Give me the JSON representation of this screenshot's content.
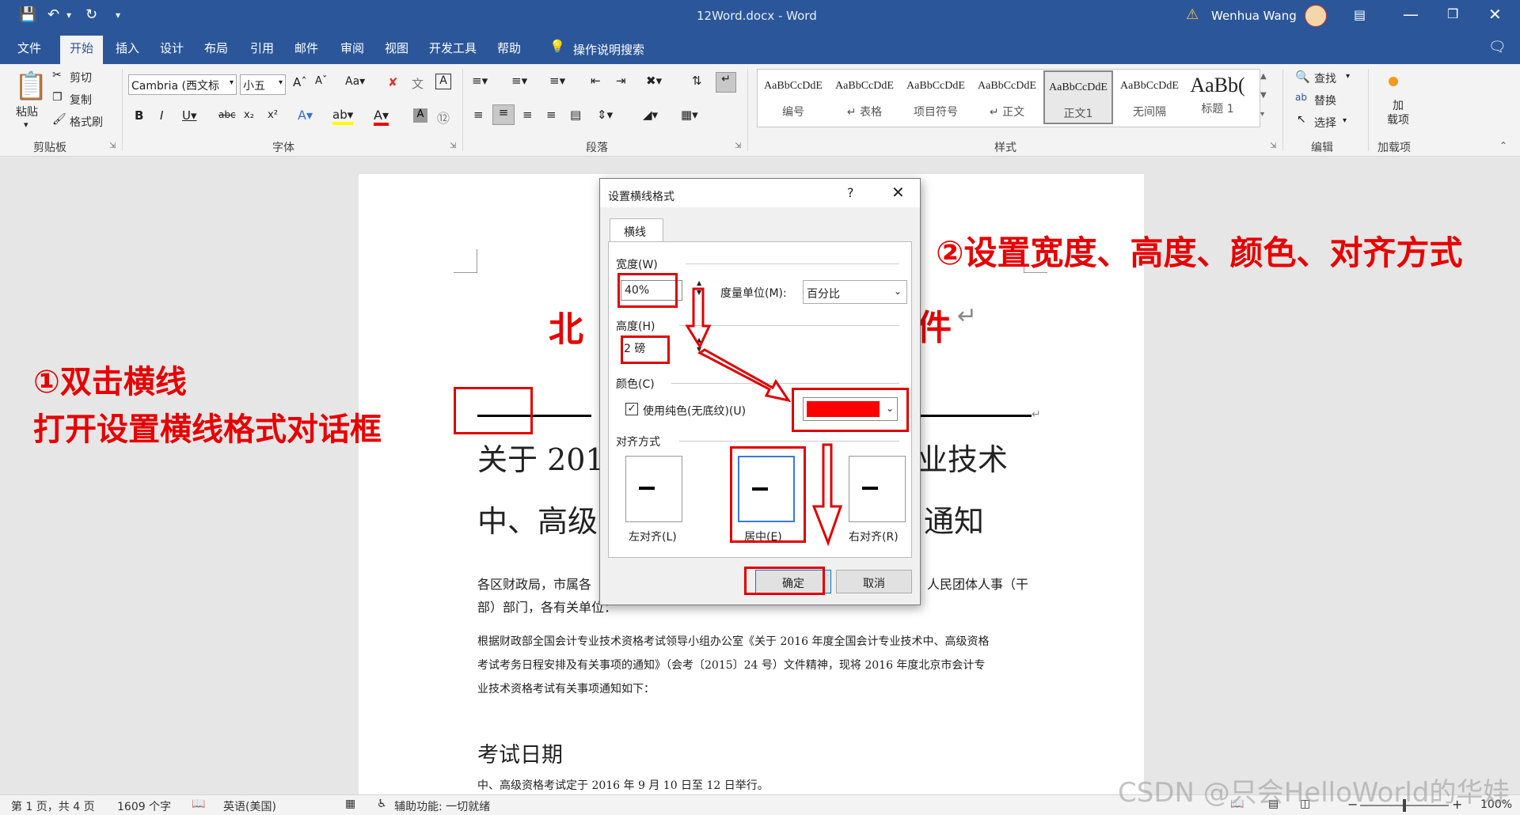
{
  "window": {
    "title": "12Word.docx - Word",
    "user": "Wenhua Wang"
  },
  "tabs": [
    "文件",
    "开始",
    "插入",
    "设计",
    "布局",
    "引用",
    "邮件",
    "审阅",
    "视图",
    "开发工具",
    "帮助"
  ],
  "tell_me": "操作说明搜索",
  "clipboard": {
    "paste": "粘贴",
    "cut": "剪切",
    "copy": "复制",
    "format_painter": "格式刷",
    "label": "剪贴板"
  },
  "font": {
    "name": "Cambria (西文标",
    "size": "小五",
    "label": "字体"
  },
  "paragraph": {
    "label": "段落"
  },
  "styles": {
    "label": "样式",
    "items": [
      {
        "sample": "AaBbCcDdE",
        "name": "编号"
      },
      {
        "sample": "AaBbCcDdE",
        "name": "↵ 表格"
      },
      {
        "sample": "AaBbCcDdE",
        "name": "项目符号"
      },
      {
        "sample": "AaBbCcDdE",
        "name": "↵ 正文"
      },
      {
        "sample": "AaBbCcDdE",
        "name": "正文1"
      },
      {
        "sample": "AaBbCcDdE",
        "name": "无间隔"
      },
      {
        "sample": "AaBb(",
        "name": "标题 1"
      }
    ]
  },
  "editing": {
    "find": "查找",
    "replace": "替换",
    "select": "选择",
    "label": "编辑"
  },
  "addins": {
    "button": "加\n载项",
    "label": "加载项"
  },
  "document": {
    "title_visible_left": "北",
    "title_visible_right": "件",
    "heading_line1_left": "关于 201",
    "heading_line1_right": "业技术",
    "heading_line2_left": "中、高级",
    "heading_line2_right": "通知",
    "para1_line1_left": "各区财政局，市属各",
    "para1_line1_right": "人民团体人事（干",
    "para1_line2": "部）部门，各有关单位：",
    "para2_line1": "根据财政部全国会计专业技术资格考试领导小组办公室《关于 2016 年度全国会计专业技术中、高级资格",
    "para2_line2": "考试考务日程安排及有关事项的通知》（会考〔2015〕24 号）文件精神，现将 2016 年度北京市会计专",
    "para2_line3": "业技术资格考试有关事项通知如下：",
    "section_heading": "考试日期",
    "para3": "中、高级资格考试定于 2016 年 9 月 10 日至 12 日举行。"
  },
  "dialog": {
    "title": "设置横线格式",
    "help": "?",
    "tab": "横线",
    "width_label": "宽度(W)",
    "width_value": "40%",
    "unit_label": "度量单位(M):",
    "unit_value": "百分比",
    "height_label": "高度(H)",
    "height_value": "2 磅",
    "color_label": "颜色(C)",
    "solid_color_label": "使用纯色(无底纹)(U)",
    "solid_color_checked": true,
    "color_value": "#ff0000",
    "align_label": "对齐方式",
    "align_left": "左对齐(L)",
    "align_center": "居中(E)",
    "align_right": "右对齐(R)",
    "align_selected": "center",
    "ok": "确定",
    "cancel": "取消"
  },
  "annotations": {
    "step1_line1": "①双击横线",
    "step1_line2": "打开设置横线格式对话框",
    "step2": "②设置宽度、高度、颜色、对齐方式"
  },
  "status": {
    "page": "第 1 页，共 4 页",
    "words": "1609 个字",
    "language": "英语(美国)",
    "accessibility": "辅助功能: 一切就绪",
    "zoom": "100%"
  },
  "watermark": "CSDN @只会HelloWorld的华娃",
  "colors": {
    "accent": "#2b579a",
    "annotation": "#e60000"
  }
}
